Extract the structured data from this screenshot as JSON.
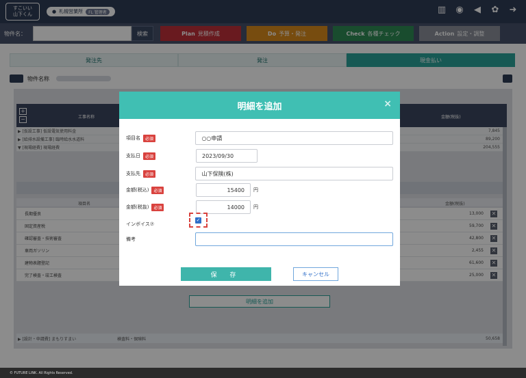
{
  "header": {
    "logo_line1": "すこいい",
    "logo_line2": "山下くん",
    "office": "札幌営業所",
    "office_tag": "FL 管理者",
    "icons": [
      "building-icon",
      "chat-icon",
      "megaphone-icon",
      "gear-icon",
      "logout-icon"
    ]
  },
  "search": {
    "label": "物件名：",
    "placeholder": "",
    "button": "検索"
  },
  "phases": [
    {
      "key": "Plan",
      "label": "見積作成",
      "color": "#c0303a"
    },
    {
      "key": "Do",
      "label": "予算・発注",
      "color": "#d98a1c"
    },
    {
      "key": "Check",
      "label": "各種チェック",
      "color": "#2e8a55"
    },
    {
      "key": "Action",
      "label": "設定・調整",
      "color": "#8a8f99"
    }
  ],
  "tabs": [
    {
      "label": "発注先",
      "active": false
    },
    {
      "label": "発注",
      "active": false
    },
    {
      "label": "現金払い",
      "active": true
    }
  ],
  "property": {
    "label": "物件名称"
  },
  "table": {
    "col_name": "工事名称",
    "col_amount": "金額(税抜)",
    "rows": [
      {
        "name": "▶ [仮設工事] 仮設電気使用料金",
        "amount": "7,845"
      },
      {
        "name": "▶ [給排水設備工事] 臨時給水水道料",
        "amount": "89,200"
      },
      {
        "name": "▼ [現場経費] 現場経費",
        "amount": "204,555"
      }
    ],
    "detail_col_item": "項目名",
    "detail_col_amount": "金額(税抜)",
    "details": [
      {
        "name": "長期優良",
        "amount": "13,000"
      },
      {
        "name": "固定資産税",
        "amount": "59,700"
      },
      {
        "name": "確認審査・技術審査",
        "amount": "42,800"
      },
      {
        "name": "車両ガソリン",
        "amount": "2,455"
      },
      {
        "name": "建物表題登記",
        "amount": "61,600"
      },
      {
        "name": "完了検査・竣工検査",
        "amount": "25,000"
      }
    ],
    "add_detail": "明細を追加",
    "bottom_row": {
      "name": "▶ [設計・申請費] まもりすまい",
      "mid": "検査料・保険料",
      "amount": "50,658"
    }
  },
  "footer": {
    "copyright": "© FUTURE LINK. All Rights Reserved."
  },
  "modal": {
    "title": "明細を追加",
    "close": "×",
    "required": "必須",
    "fields": {
      "item_label": "項目名",
      "item_value": "○○申請",
      "date_label": "支払日",
      "date_value": "2023/09/30",
      "payee_label": "支払先",
      "payee_value": "山下保険(株)",
      "tax_in_label": "金額(税込)",
      "tax_in_value": "15400",
      "tax_ex_label": "金額(税抜)",
      "tax_ex_value": "14000",
      "yen": "円",
      "invoice_label": "インボイス⑦",
      "invoice_checked": true,
      "remark_label": "備考",
      "remark_value": ""
    },
    "save": "保 存",
    "cancel": "キャンセル"
  }
}
